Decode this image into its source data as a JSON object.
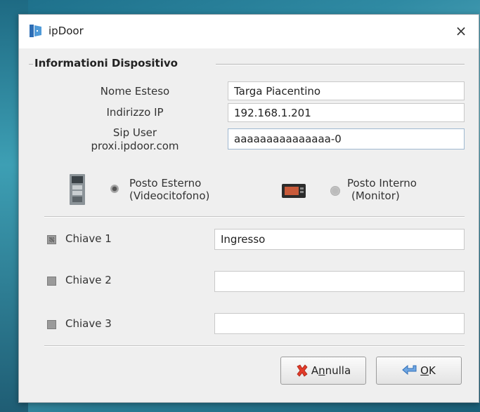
{
  "window": {
    "title": "ipDoor",
    "close_glyph": "×"
  },
  "group": {
    "title": "Informationi Dispositivo"
  },
  "fields": {
    "nome_esteso": {
      "label": "Nome Esteso",
      "value": "Targa Piacentino"
    },
    "indirizzo_ip": {
      "label": "Indirizzo IP",
      "value": "192.168.1.201"
    },
    "sip_user": {
      "label_line1": "Sip User",
      "label_line2": "proxi.ipdoor.com",
      "value": "aaaaaaaaaaaaaaa-0"
    }
  },
  "device_type": {
    "esterno": {
      "line1": "Posto Esterno",
      "line2": "(Videocitofono)",
      "selected": true
    },
    "interno": {
      "line1": "Posto Interno",
      "line2": "(Monitor)",
      "selected": false
    }
  },
  "keys": [
    {
      "label": "Chiave 1",
      "value": "Ingresso",
      "checked": true
    },
    {
      "label": "Chiave 2",
      "value": "",
      "checked": false
    },
    {
      "label": "Chiave 3",
      "value": "",
      "checked": false
    }
  ],
  "buttons": {
    "annulla": {
      "label_pre": "A",
      "label_mnemonic": "n",
      "label_post": "nulla"
    },
    "ok": {
      "label_mnemonic": "O",
      "label_post": "K"
    }
  },
  "colors": {
    "accent_red": "#e23b2a",
    "accent_blue": "#2f7bd6"
  }
}
